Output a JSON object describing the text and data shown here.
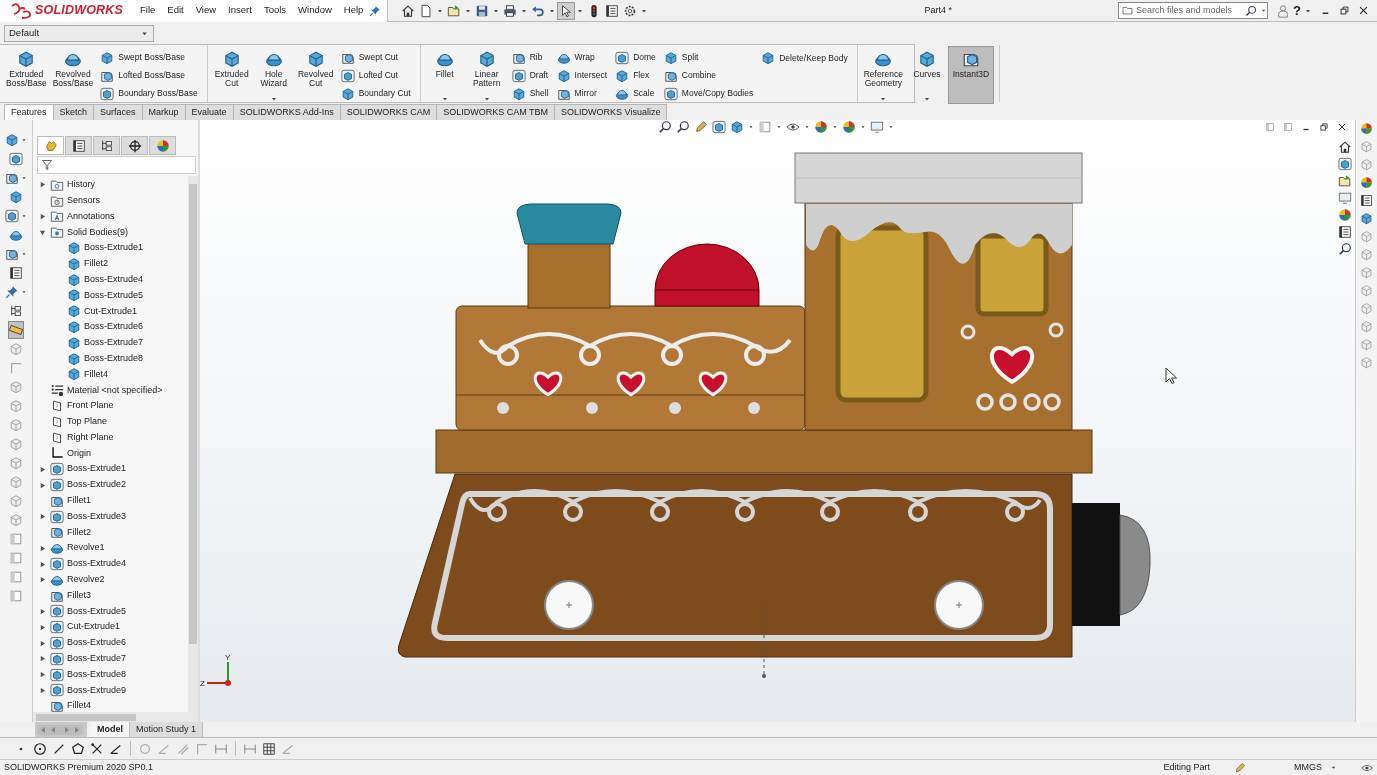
{
  "app": {
    "logo_text": "SOLIDWORKS",
    "document_title": "Part4 *"
  },
  "menu": [
    "File",
    "Edit",
    "View",
    "Insert",
    "Tools",
    "Window",
    "Help"
  ],
  "quick_access_select": {
    "selected": true
  },
  "search": {
    "placeholder": "Search files and models"
  },
  "help_label": "?",
  "configuration": {
    "value": "Default"
  },
  "ribbon": [
    {
      "columns": [
        {
          "kind": "large",
          "label": "Extruded\nBoss/Base",
          "has_menu": false,
          "selected": false
        },
        {
          "kind": "large",
          "label": "Revolved\nBoss/Base",
          "has_menu": false,
          "selected": false
        },
        {
          "kind": "stack",
          "items": [
            "Swept Boss/Base",
            "Lofted Boss/Base",
            "Boundary Boss/Base"
          ]
        }
      ]
    },
    {
      "columns": [
        {
          "kind": "large",
          "label": "Extruded\nCut",
          "has_menu": false,
          "selected": false
        },
        {
          "kind": "large",
          "label": "Hole\nWizard",
          "has_menu": true,
          "selected": false
        },
        {
          "kind": "large",
          "label": "Revolved\nCut",
          "has_menu": false,
          "selected": false
        },
        {
          "kind": "stack",
          "items": [
            "Swept Cut",
            "Lofted Cut",
            "Boundary Cut"
          ]
        }
      ]
    },
    {
      "columns": [
        {
          "kind": "large",
          "label": "Fillet",
          "has_menu": true,
          "selected": false
        },
        {
          "kind": "large",
          "label": "Linear\nPattern",
          "has_menu": true,
          "selected": false
        },
        {
          "kind": "stack",
          "items": [
            "Rib",
            "Draft",
            "Shell"
          ]
        },
        {
          "kind": "stack",
          "items": [
            "Wrap",
            "Intersect",
            "Mirror"
          ]
        },
        {
          "kind": "stack",
          "items": [
            "Dome",
            "Flex",
            "Scale"
          ]
        },
        {
          "kind": "stack",
          "items": [
            "Split",
            "Combine",
            "Move/Copy Bodies"
          ]
        },
        {
          "kind": "stack",
          "items": [
            "Delete/Keep Body"
          ]
        }
      ]
    },
    {
      "columns": [
        {
          "kind": "large",
          "label": "Reference\nGeometry",
          "has_menu": true,
          "selected": false
        },
        {
          "kind": "large",
          "label": "Curves",
          "has_menu": true,
          "selected": false
        },
        {
          "kind": "large",
          "label": "Instant3D",
          "has_menu": false,
          "selected": true
        }
      ]
    }
  ],
  "tabs": [
    {
      "label": "Features",
      "selected": true
    },
    {
      "label": "Sketch",
      "selected": false
    },
    {
      "label": "Surfaces",
      "selected": false
    },
    {
      "label": "Markup",
      "selected": false
    },
    {
      "label": "Evaluate",
      "selected": false
    },
    {
      "label": "SOLIDWORKS Add-Ins",
      "selected": false
    },
    {
      "label": "SOLIDWORKS CAM",
      "selected": false
    },
    {
      "label": "SOLIDWORKS CAM TBM",
      "selected": false
    },
    {
      "label": "SOLIDWORKS Visualize",
      "selected": false
    }
  ],
  "panel_tabs": [
    {
      "selected": true
    },
    {
      "selected": false
    },
    {
      "selected": false
    },
    {
      "selected": false
    },
    {
      "selected": false
    }
  ],
  "tree": [
    {
      "label": "History",
      "kind": "folder",
      "expanded": false
    },
    {
      "label": "Sensors",
      "kind": "sensor"
    },
    {
      "label": "Annotations",
      "kind": "annotation",
      "expanded": false
    },
    {
      "label": "Solid Bodies(9)",
      "kind": "bodies",
      "expanded": true,
      "children": [
        {
          "label": "Boss-Extrude1",
          "kind": "body"
        },
        {
          "label": "Fillet2",
          "kind": "body"
        },
        {
          "label": "Boss-Extrude4",
          "kind": "body"
        },
        {
          "label": "Boss-Extrude5",
          "kind": "body"
        },
        {
          "label": "Cut-Extrude1",
          "kind": "body"
        },
        {
          "label": "Boss-Extrude6",
          "kind": "body"
        },
        {
          "label": "Boss-Extrude7",
          "kind": "body"
        },
        {
          "label": "Boss-Extrude8",
          "kind": "body"
        },
        {
          "label": "Fillet4",
          "kind": "body"
        }
      ]
    },
    {
      "label": "Material <not specified>",
      "kind": "material"
    },
    {
      "label": "Front Plane",
      "kind": "plane"
    },
    {
      "label": "Top Plane",
      "kind": "plane"
    },
    {
      "label": "Right Plane",
      "kind": "plane"
    },
    {
      "label": "Origin",
      "kind": "origin"
    },
    {
      "label": "Boss-Extrude1",
      "kind": "extrude",
      "expanded": false
    },
    {
      "label": "Boss-Extrude2",
      "kind": "extrude",
      "expanded": false
    },
    {
      "label": "Fillet1",
      "kind": "fillet"
    },
    {
      "label": "Boss-Extrude3",
      "kind": "extrude",
      "expanded": false
    },
    {
      "label": "Fillet2",
      "kind": "fillet"
    },
    {
      "label": "Revolve1",
      "kind": "revolve",
      "expanded": false
    },
    {
      "label": "Boss-Extrude4",
      "kind": "extrude",
      "expanded": false
    },
    {
      "label": "Revolve2",
      "kind": "revolve",
      "expanded": false
    },
    {
      "label": "Fillet3",
      "kind": "fillet"
    },
    {
      "label": "Boss-Extrude5",
      "kind": "extrude",
      "expanded": false
    },
    {
      "label": "Cut-Extrude1",
      "kind": "cut",
      "expanded": false
    },
    {
      "label": "Boss-Extrude6",
      "kind": "extrude",
      "expanded": false
    },
    {
      "label": "Boss-Extrude7",
      "kind": "extrude",
      "expanded": false
    },
    {
      "label": "Boss-Extrude8",
      "kind": "extrude",
      "expanded": false
    },
    {
      "label": "Boss-Extrude9",
      "kind": "extrude",
      "expanded": false
    },
    {
      "label": "Fillet4",
      "kind": "fillet"
    }
  ],
  "triad": {
    "y_label": "Y",
    "z_label": "Z"
  },
  "bottom_tabs": [
    {
      "label": "Model",
      "selected": true
    },
    {
      "label": "Motion Study 1",
      "selected": false
    }
  ],
  "status_bar": {
    "version": "SOLIDWORKS Premium 2020 SP0.1",
    "mode": "Editing Part",
    "units": "MMGS"
  }
}
